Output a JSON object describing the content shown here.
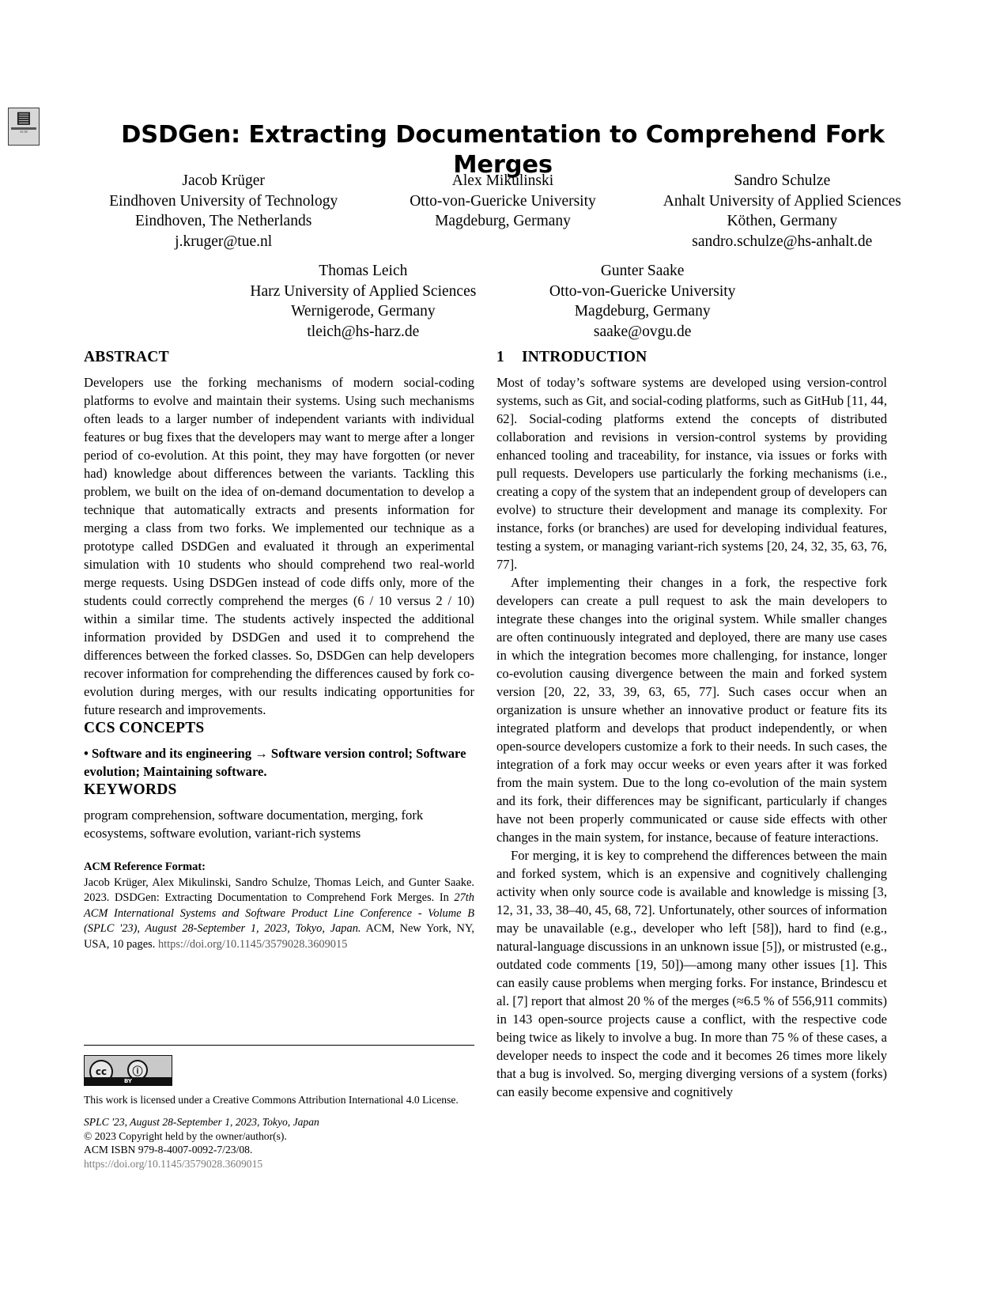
{
  "paper": {
    "title": "DSDGen: Extracting Documentation to Comprehend Fork Merges",
    "badge": {
      "glyph": "▤",
      "caption": "ACM"
    }
  },
  "authors": [
    {
      "name": "Jacob Krüger",
      "affiliation": "Eindhoven University of Technology",
      "location": "Eindhoven, The Netherlands",
      "email": "j.kruger@tue.nl"
    },
    {
      "name": "Alex Mikulinski",
      "affiliation": "Otto-von-Guericke University",
      "location": "Magdeburg, Germany",
      "email": ""
    },
    {
      "name": "Sandro Schulze",
      "affiliation": "Anhalt University of Applied Sciences",
      "location": "Köthen, Germany",
      "email": "sandro.schulze@hs-anhalt.de"
    },
    {
      "name": "Thomas Leich",
      "affiliation": "Harz University of Applied Sciences",
      "location": "Wernigerode, Germany",
      "email": "tleich@hs-harz.de"
    },
    {
      "name": "Gunter Saake",
      "affiliation": "Otto-von-Guericke University",
      "location": "Magdeburg, Germany",
      "email": "saake@ovgu.de"
    }
  ],
  "abstract": {
    "heading": "ABSTRACT",
    "text": "Developers use the forking mechanisms of modern social-coding platforms to evolve and maintain their systems. Using such mechanisms often leads to a larger number of independent variants with individual features or bug fixes that the developers may want to merge after a longer period of co-evolution. At this point, they may have forgotten (or never had) knowledge about differences between the variants. Tackling this problem, we built on the idea of on-demand documentation to develop a technique that automatically extracts and presents information for merging a class from two forks. We implemented our technique as a prototype called DSDGen and evaluated it through an experimental simulation with 10 students who should comprehend two real-world merge requests. Using DSDGen instead of code diffs only, more of the students could correctly comprehend the merges (6 / 10 versus 2 / 10) within a similar time. The students actively inspected the additional information provided by DSDGen and used it to comprehend the differences between the forked classes. So, DSDGen can help developers recover information for comprehending the differences caused by fork co-evolution during merges, with our results indicating opportunities for future research and improvements."
  },
  "ccs_concepts": {
    "heading": "CCS CONCEPTS",
    "text": "• Software and its engineering → Software version control; Software evolution; Maintaining software."
  },
  "keywords": {
    "heading": "KEYWORDS",
    "text": "program comprehension, software documentation, merging, fork ecosystems, software evolution, variant-rich systems"
  },
  "acm_reference": {
    "heading": "ACM Reference Format:",
    "plain_1": "Jacob Krüger, Alex Mikulinski, Sandro Schulze, Thomas Leich, and Gunter Saake. 2023. DSDGen: Extracting Documentation to Comprehend Fork Merges. In ",
    "italic_1": "27th ACM International Systems and Software Product Line Conference - Volume B (SPLC '23), August 28-September 1, 2023, Tokyo, Japan.",
    "plain_2": " ACM, New York, NY, USA, 10 pages. ",
    "doi": "https://doi.org/10.1145/3579028.3609015"
  },
  "license": {
    "statement": "This work is licensed under a Creative Commons Attribution International 4.0 License.",
    "badge": {
      "cc_text": "cc",
      "by_text": "BY",
      "person_glyph": "ⓘ"
    }
  },
  "footer": {
    "venue": "SPLC '23, August 28-September 1, 2023, Tokyo, Japan",
    "copyright": "© 2023 Copyright held by the owner/author(s).",
    "isbn": "ACM ISBN 979-8-4007-0092-7/23/08.",
    "doi": "https://doi.org/10.1145/3579028.3609015"
  },
  "introduction": {
    "number": "1",
    "heading": "INTRODUCTION",
    "paragraphs": [
      "Most of today’s software systems are developed using version-control systems, such as Git, and social-coding platforms, such as GitHub [11, 44, 62]. Social-coding platforms extend the concepts of distributed collaboration and revisions in version-control systems by providing enhanced tooling and traceability, for instance, via issues or forks with pull requests. Developers use particularly the forking mechanisms (i.e., creating a copy of the system that an independent group of developers can evolve) to structure their development and manage its complexity. For instance, forks (or branches) are used for developing individual features, testing a system, or managing variant-rich systems [20, 24, 32, 35, 63, 76, 77].",
      "After implementing their changes in a fork, the respective fork developers can create a pull request to ask the main developers to integrate these changes into the original system. While smaller changes are often continuously integrated and deployed, there are many use cases in which the integration becomes more challenging, for instance, longer co-evolution causing divergence between the main and forked system version [20, 22, 33, 39, 63, 65, 77]. Such cases occur when an organization is unsure whether an innovative product or feature fits its integrated platform and develops that product independently, or when open-source developers customize a fork to their needs. In such cases, the integration of a fork may occur weeks or even years after it was forked from the main system. Due to the long co-evolution of the main system and its fork, their differences may be significant, particularly if changes have not been properly communicated or cause side effects with other changes in the main system, for instance, because of feature interactions.",
      "For merging, it is key to comprehend the differences between the main and forked system, which is an expensive and cognitively challenging activity when only source code is available and knowledge is missing [3, 12, 31, 33, 38–40, 45, 68, 72]. Unfortunately, other sources of information may be unavailable (e.g., developer who left [58]), hard to find (e.g., natural-language discussions in an unknown issue [5]), or mistrusted (e.g., outdated code comments [19, 50])—among many other issues [1]. This can easily cause problems when merging forks. For instance, Brindescu et al. [7] report that almost 20 % of the merges (≈6.5 % of 556,911 commits) in 143 open-source projects cause a conflict, with the respective code being twice as likely to involve a bug. In more than 75 % of these cases, a developer needs to inspect the code and it becomes 26 times more likely that a bug is involved. So, merging diverging versions of a system (forks) can easily become expensive and cognitively"
    ]
  }
}
